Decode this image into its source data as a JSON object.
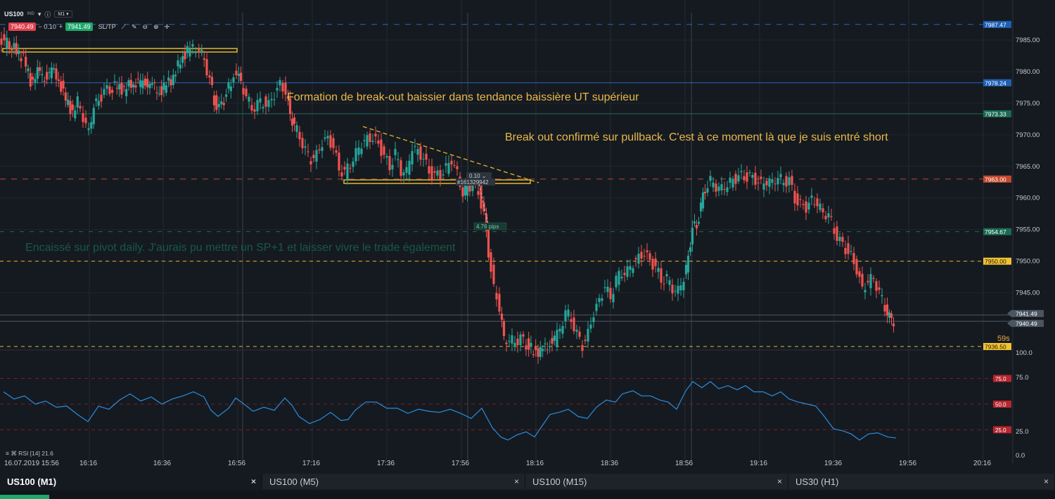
{
  "toolbar": {
    "symbol": "US100",
    "type_badge": "IND",
    "timeframe": "M1",
    "sell_price": "7940.49",
    "spread": "− 0.10",
    "plus": "+",
    "buy_price": "7941.49",
    "sltp_label": "SL/TP",
    "icons": [
      "dropdown-icon",
      "info-icon",
      "chevron-down-icon",
      "line-tool-icon",
      "draw-icon",
      "zoom-out-icon",
      "zoom-in-icon",
      "crosshair-icon"
    ]
  },
  "annotations": {
    "formation": "Formation de break-out baissier dans tendance baissière UT supérieur",
    "breakout": "Break out confirmé sur pullback. C'est à ce moment là que je suis entré short",
    "pivot": "Encaissé sur pivot daily. J'aurais pu mettre un SP+1 et laisser vivre le trade également"
  },
  "trade": {
    "lot": "0.10",
    "order_id": "#161329942",
    "pips": "4.76 pips"
  },
  "price_axis": {
    "ticks": [
      "7985.00",
      "7980.00",
      "7975.00",
      "7970.00",
      "7965.00",
      "7960.00",
      "7955.00",
      "7950.00",
      "7945.00"
    ],
    "labels": [
      {
        "value": "7987.47",
        "color": "#1e5fb4"
      },
      {
        "value": "7978.24",
        "color": "#1e5fb4"
      },
      {
        "value": "7973.33",
        "color": "#1a6b52"
      },
      {
        "value": "7963.00",
        "color": "#c5482d"
      },
      {
        "value": "7954.67",
        "color": "#1a6b52"
      },
      {
        "value": "7950.00",
        "color": "#f2c230"
      },
      {
        "value": "7941.49",
        "color": "#4b5561"
      },
      {
        "value": "7940.49",
        "color": "#4b5561"
      },
      {
        "value": "7936.50",
        "color": "#f2c230"
      }
    ],
    "countdown": "59s"
  },
  "rsi": {
    "label": "RSI [14] 21.6",
    "ticks": [
      "100.0",
      "75.0",
      "25.0",
      "0.0"
    ],
    "levels": [
      {
        "value": "75.0",
        "color": "#b8262f"
      },
      {
        "value": "50.0",
        "color": "#b8262f"
      },
      {
        "value": "25.0",
        "color": "#b8262f"
      }
    ]
  },
  "time_axis": {
    "labels": [
      "16.07.2019 15:56",
      "16:16",
      "16:36",
      "16:56",
      "17:16",
      "17:36",
      "17:56",
      "18:16",
      "18:36",
      "18:56",
      "19:16",
      "19:36",
      "19:56",
      "20:16"
    ]
  },
  "tabs": [
    {
      "label": "US100 (M1)",
      "active": true
    },
    {
      "label": "US100 (M5)",
      "active": false
    },
    {
      "label": "US100 (M15)",
      "active": false
    },
    {
      "label": "US30 (H1)",
      "active": false
    }
  ],
  "colors": {
    "bull": "#26a69a",
    "bear": "#ef5350",
    "annotation": "#e8b84a",
    "rsi_line": "#2a8de0",
    "background": "#151a20"
  },
  "chart_data": {
    "type": "candlestick",
    "price_range": [
      7936,
      7989
    ],
    "rsi_range": [
      0,
      100
    ],
    "rsi_levels": [
      75,
      50,
      25
    ],
    "horizontal_levels": [
      7987.47,
      7978.24,
      7973.33,
      7963.0,
      7954.67,
      7950.0,
      7936.5
    ],
    "close_path": [
      [
        0,
        7985.8
      ],
      [
        8,
        7984.5
      ],
      [
        15,
        7984.5
      ],
      [
        25,
        7983.2
      ],
      [
        35,
        7982.2
      ],
      [
        45,
        7978.5
      ],
      [
        55,
        7979.8
      ],
      [
        65,
        7979.2
      ],
      [
        75,
        7980.1
      ],
      [
        85,
        7978.8
      ],
      [
        95,
        7975.5
      ],
      [
        105,
        7973.5
      ],
      [
        112,
        7975.2
      ],
      [
        120,
        7972.8
      ],
      [
        128,
        7970.5
      ],
      [
        135,
        7974.5
      ],
      [
        142,
        7975.5
      ],
      [
        150,
        7976.8
      ],
      [
        158,
        7977.2
      ],
      [
        168,
        7977.8
      ],
      [
        178,
        7977.0
      ],
      [
        188,
        7978.3
      ],
      [
        198,
        7977.9
      ],
      [
        208,
        7978.6
      ],
      [
        218,
        7977.6
      ],
      [
        228,
        7976.8
      ],
      [
        238,
        7977.9
      ],
      [
        248,
        7979.1
      ],
      [
        258,
        7981.8
      ],
      [
        268,
        7983.2
      ],
      [
        276,
        7983.8
      ],
      [
        285,
        7983.5
      ],
      [
        292,
        7982.0
      ],
      [
        300,
        7978.6
      ],
      [
        306,
        7975.4
      ],
      [
        313,
        7974.0
      ],
      [
        320,
        7975.6
      ],
      [
        330,
        7978.5
      ],
      [
        338,
        7980.0
      ],
      [
        344,
        7978.3
      ],
      [
        352,
        7976.0
      ],
      [
        360,
        7974.3
      ],
      [
        368,
        7974.8
      ],
      [
        376,
        7975.3
      ],
      [
        384,
        7974.6
      ],
      [
        392,
        7976.4
      ],
      [
        400,
        7978.1
      ],
      [
        408,
        7976.6
      ],
      [
        414,
        7973.4
      ],
      [
        420,
        7971.3
      ],
      [
        428,
        7970.0
      ],
      [
        436,
        7967.3
      ],
      [
        444,
        7966.2
      ],
      [
        452,
        7966.8
      ],
      [
        460,
        7968.6
      ],
      [
        468,
        7969.6
      ],
      [
        476,
        7967.8
      ],
      [
        484,
        7964.8
      ],
      [
        492,
        7963.8
      ],
      [
        500,
        7965.6
      ],
      [
        508,
        7967.0
      ],
      [
        516,
        7968.6
      ],
      [
        524,
        7969.4
      ],
      [
        532,
        7969.3
      ],
      [
        540,
        7968.7
      ],
      [
        548,
        7966.4
      ],
      [
        556,
        7965.1
      ],
      [
        564,
        7966.9
      ],
      [
        572,
        7964.4
      ],
      [
        580,
        7964.1
      ],
      [
        588,
        7968.0
      ],
      [
        596,
        7967.5
      ],
      [
        604,
        7966.1
      ],
      [
        612,
        7964.3
      ],
      [
        620,
        7963.3
      ],
      [
        628,
        7963.9
      ],
      [
        636,
        7964.6
      ],
      [
        644,
        7966.1
      ],
      [
        652,
        7964.0
      ],
      [
        660,
        7960.5
      ],
      [
        666,
        7962.0
      ],
      [
        674,
        7961.8
      ],
      [
        682,
        7961.2
      ],
      [
        690,
        7957.0
      ],
      [
        696,
        7951.5
      ],
      [
        704,
        7945.6
      ],
      [
        712,
        7942.6
      ],
      [
        718,
        7937.9
      ],
      [
        726,
        7937.3
      ],
      [
        734,
        7937.5
      ],
      [
        742,
        7937.7
      ],
      [
        750,
        7936.9
      ],
      [
        760,
        7935.8
      ],
      [
        770,
        7935.6
      ],
      [
        780,
        7936.8
      ],
      [
        790,
        7937.4
      ],
      [
        798,
        7939.4
      ],
      [
        806,
        7941.8
      ],
      [
        814,
        7941.1
      ],
      [
        822,
        7938.3
      ],
      [
        830,
        7936.7
      ],
      [
        838,
        7938.5
      ],
      [
        846,
        7941.7
      ],
      [
        854,
        7943.9
      ],
      [
        862,
        7945.8
      ],
      [
        870,
        7944.4
      ],
      [
        878,
        7947.0
      ],
      [
        886,
        7948.4
      ],
      [
        894,
        7948.3
      ],
      [
        902,
        7949.7
      ],
      [
        910,
        7950.6
      ],
      [
        918,
        7951.1
      ],
      [
        926,
        7950.3
      ],
      [
        934,
        7948.8
      ],
      [
        942,
        7947.3
      ],
      [
        950,
        7947.1
      ],
      [
        958,
        7945.8
      ],
      [
        966,
        7945.3
      ],
      [
        974,
        7947.3
      ],
      [
        980,
        7950.6
      ],
      [
        986,
        7955.2
      ],
      [
        992,
        7955.6
      ],
      [
        998,
        7958.6
      ],
      [
        1004,
        7961.6
      ],
      [
        1012,
        7962.6
      ],
      [
        1020,
        7961.8
      ],
      [
        1028,
        7961.6
      ],
      [
        1036,
        7962.0
      ],
      [
        1044,
        7963.0
      ],
      [
        1052,
        7963.2
      ],
      [
        1060,
        7963.5
      ],
      [
        1068,
        7963.2
      ],
      [
        1076,
        7963.0
      ],
      [
        1084,
        7962.2
      ],
      [
        1092,
        7962.6
      ],
      [
        1100,
        7962.7
      ],
      [
        1108,
        7963.1
      ],
      [
        1116,
        7962.8
      ],
      [
        1124,
        7962.6
      ],
      [
        1132,
        7960.0
      ],
      [
        1140,
        7958.8
      ],
      [
        1148,
        7958.5
      ],
      [
        1156,
        7959.8
      ],
      [
        1164,
        7959.0
      ],
      [
        1172,
        7957.8
      ],
      [
        1180,
        7957.2
      ],
      [
        1188,
        7955.0
      ],
      [
        1196,
        7953.0
      ],
      [
        1204,
        7952.0
      ],
      [
        1212,
        7950.8
      ],
      [
        1220,
        7948.5
      ],
      [
        1228,
        7945.7
      ],
      [
        1236,
        7946.6
      ],
      [
        1244,
        7947.6
      ],
      [
        1252,
        7944.8
      ],
      [
        1260,
        7942.9
      ],
      [
        1266,
        7941.0
      ],
      [
        1272,
        7940.5
      ]
    ],
    "rsi_path": [
      [
        5,
        62
      ],
      [
        20,
        55
      ],
      [
        35,
        58
      ],
      [
        50,
        50
      ],
      [
        65,
        53
      ],
      [
        80,
        47
      ],
      [
        95,
        48
      ],
      [
        110,
        40
      ],
      [
        125,
        33
      ],
      [
        140,
        48
      ],
      [
        155,
        45
      ],
      [
        170,
        54
      ],
      [
        185,
        60
      ],
      [
        200,
        53
      ],
      [
        215,
        57
      ],
      [
        230,
        50
      ],
      [
        245,
        55
      ],
      [
        260,
        58
      ],
      [
        275,
        62
      ],
      [
        290,
        57
      ],
      [
        300,
        44
      ],
      [
        310,
        38
      ],
      [
        325,
        46
      ],
      [
        335,
        56
      ],
      [
        345,
        51
      ],
      [
        360,
        43
      ],
      [
        375,
        47
      ],
      [
        390,
        44
      ],
      [
        405,
        56
      ],
      [
        415,
        49
      ],
      [
        425,
        38
      ],
      [
        440,
        31
      ],
      [
        455,
        35
      ],
      [
        470,
        42
      ],
      [
        485,
        34
      ],
      [
        495,
        35
      ],
      [
        505,
        44
      ],
      [
        520,
        52
      ],
      [
        535,
        52
      ],
      [
        550,
        46
      ],
      [
        565,
        46
      ],
      [
        580,
        41
      ],
      [
        595,
        45
      ],
      [
        610,
        43
      ],
      [
        625,
        42
      ],
      [
        640,
        45
      ],
      [
        655,
        41
      ],
      [
        670,
        36
      ],
      [
        685,
        46
      ],
      [
        700,
        27
      ],
      [
        712,
        18
      ],
      [
        722,
        15
      ],
      [
        735,
        20
      ],
      [
        748,
        23
      ],
      [
        760,
        18
      ],
      [
        770,
        28
      ],
      [
        782,
        40
      ],
      [
        795,
        42
      ],
      [
        808,
        45
      ],
      [
        822,
        38
      ],
      [
        835,
        36
      ],
      [
        848,
        47
      ],
      [
        862,
        54
      ],
      [
        875,
        52
      ],
      [
        885,
        60
      ],
      [
        900,
        63
      ],
      [
        912,
        58
      ],
      [
        925,
        58
      ],
      [
        938,
        54
      ],
      [
        950,
        52
      ],
      [
        962,
        45
      ],
      [
        975,
        63
      ],
      [
        985,
        72
      ],
      [
        998,
        66
      ],
      [
        1010,
        72
      ],
      [
        1022,
        65
      ],
      [
        1035,
        68
      ],
      [
        1048,
        64
      ],
      [
        1060,
        68
      ],
      [
        1072,
        62
      ],
      [
        1085,
        62
      ],
      [
        1098,
        58
      ],
      [
        1110,
        62
      ],
      [
        1122,
        55
      ],
      [
        1135,
        52
      ],
      [
        1148,
        50
      ],
      [
        1160,
        48
      ],
      [
        1172,
        38
      ],
      [
        1185,
        26
      ],
      [
        1198,
        24
      ],
      [
        1210,
        21
      ],
      [
        1222,
        15
      ],
      [
        1235,
        21
      ],
      [
        1248,
        22
      ],
      [
        1262,
        18
      ],
      [
        1274,
        17
      ]
    ]
  }
}
